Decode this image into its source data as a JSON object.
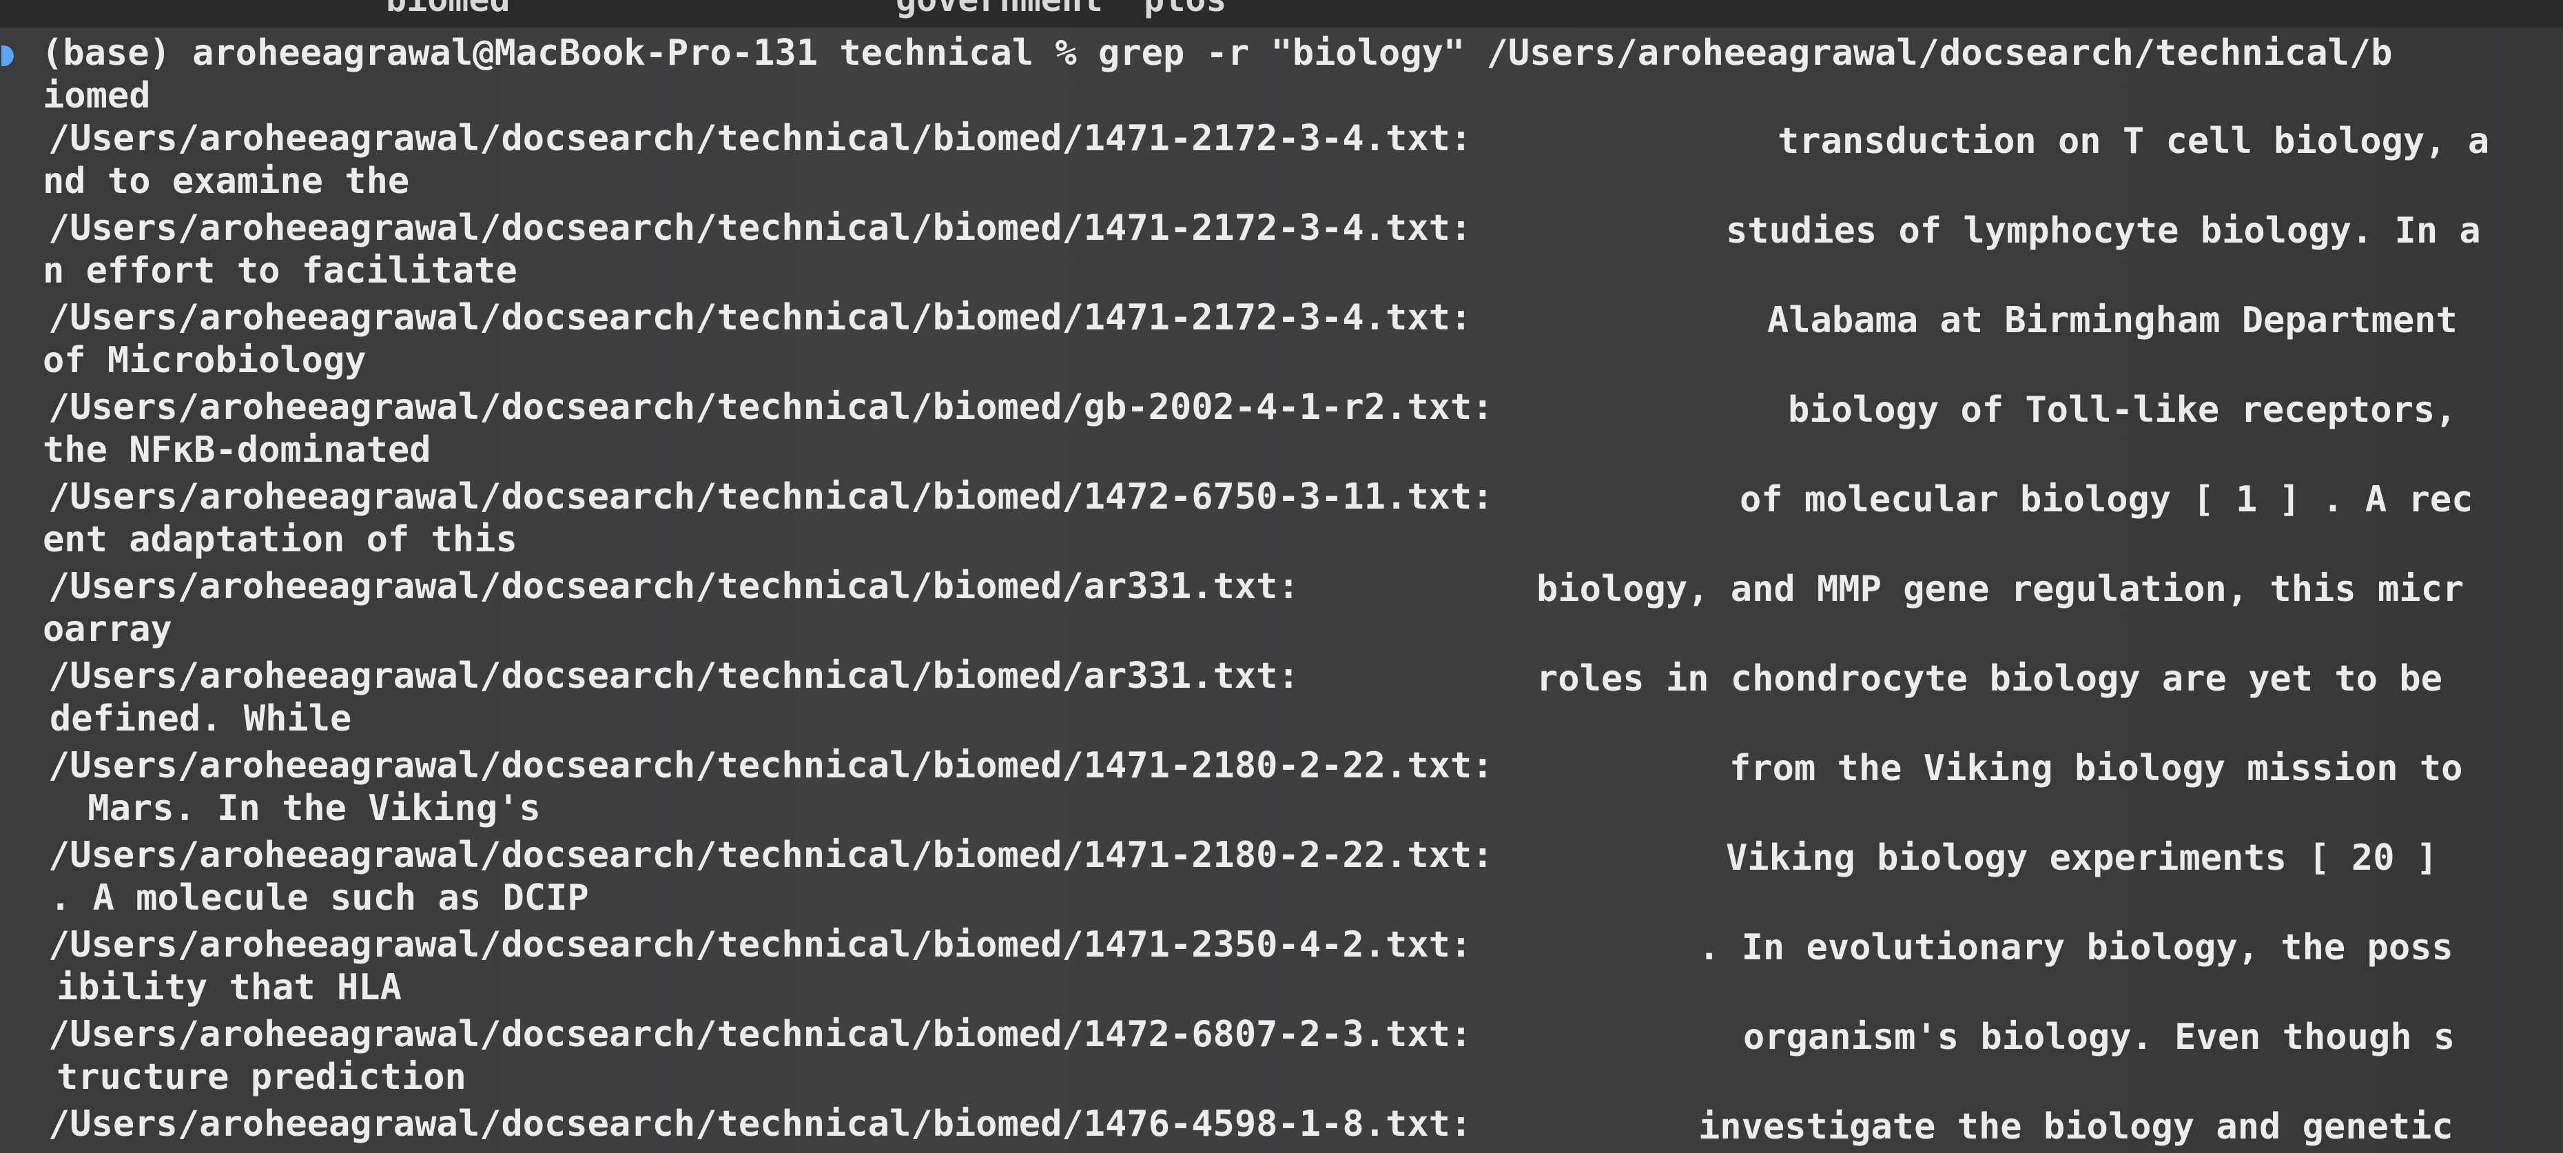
{
  "top_fragment": {
    "left": "biomed",
    "middle": "government",
    "right": "plos"
  },
  "command": {
    "line1": "(base) aroheeagrawal@MacBook-Pro-131 technical % grep -r \"biology\" /Users/aroheeagrawal/docsearch/technical/b",
    "line2": "iomed"
  },
  "results": [
    {
      "path": "/Users/aroheeagrawal/docsearch/technical/biomed/1471-2172-3-4.txt:",
      "match": "transduction on T cell biology, a",
      "cont": "nd to examine the"
    },
    {
      "path": "/Users/aroheeagrawal/docsearch/technical/biomed/1471-2172-3-4.txt:",
      "match": "studies of lymphocyte biology. In a",
      "cont": "n effort to facilitate"
    },
    {
      "path": "/Users/aroheeagrawal/docsearch/technical/biomed/1471-2172-3-4.txt:",
      "match": "Alabama at Birmingham Department",
      "cont": "of Microbiology"
    },
    {
      "path": "/Users/aroheeagrawal/docsearch/technical/biomed/gb-2002-4-1-r2.txt:",
      "match": "biology of Toll-like receptors,",
      "cont": "the NFκB-dominated"
    },
    {
      "path": "/Users/aroheeagrawal/docsearch/technical/biomed/1472-6750-3-11.txt:",
      "match": "of molecular biology [ 1 ] . A rec",
      "cont": "ent adaptation of this"
    },
    {
      "path": "/Users/aroheeagrawal/docsearch/technical/biomed/ar331.txt:",
      "match": "biology, and MMP gene regulation, this micr",
      "cont": "oarray"
    },
    {
      "path": "/Users/aroheeagrawal/docsearch/technical/biomed/ar331.txt:",
      "match": "roles in chondrocyte biology are yet to be",
      "cont": "defined. While"
    },
    {
      "path": "/Users/aroheeagrawal/docsearch/technical/biomed/1471-2180-2-22.txt:",
      "match": "from the Viking biology mission to",
      "cont": " Mars. In the Viking's"
    },
    {
      "path": "/Users/aroheeagrawal/docsearch/technical/biomed/1471-2180-2-22.txt:",
      "match": "Viking biology experiments [ 20 ]",
      "cont": ". A molecule such as DCIP"
    },
    {
      "path": "/Users/aroheeagrawal/docsearch/technical/biomed/1471-2350-4-2.txt:",
      "match": ". In evolutionary biology, the poss",
      "cont": "ibility that HLA"
    },
    {
      "path": "/Users/aroheeagrawal/docsearch/technical/biomed/1472-6807-2-3.txt:",
      "match": "organism's biology. Even though s",
      "cont": "tructure prediction"
    },
    {
      "path": "/Users/aroheeagrawal/docsearch/technical/biomed/1476-4598-1-8.txt:",
      "match": "investigate the biology and genetic",
      "cont": ""
    }
  ]
}
